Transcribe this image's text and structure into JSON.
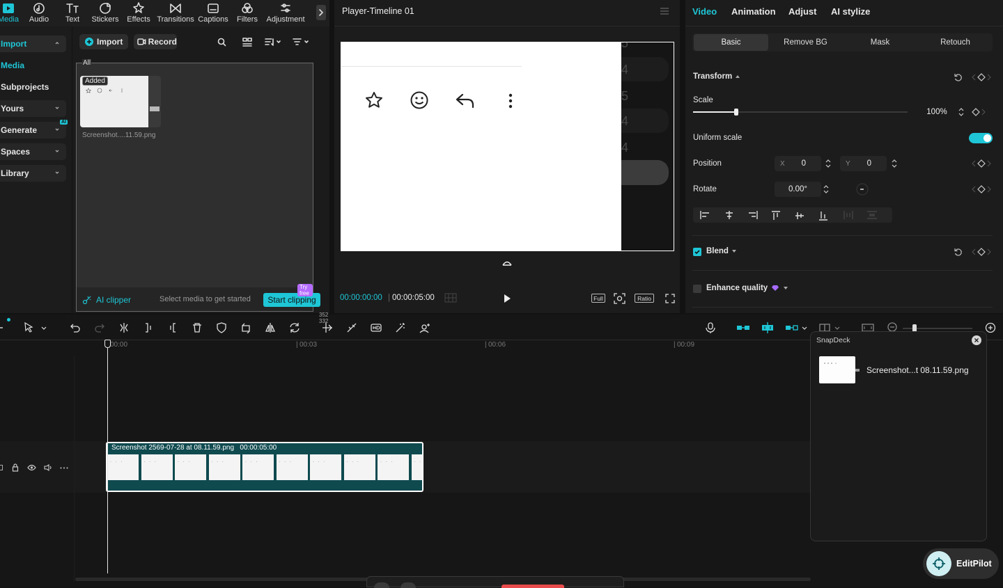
{
  "colors": {
    "accent": "#1ec6d6",
    "clip_bg": "#0f4a4f",
    "bg": "#121212"
  },
  "toolbar": {
    "items": [
      {
        "label": "Media",
        "icon": "media-icon"
      },
      {
        "label": "Audio",
        "icon": "audio-icon"
      },
      {
        "label": "Text",
        "icon": "text-icon"
      },
      {
        "label": "Stickers",
        "icon": "stickers-icon"
      },
      {
        "label": "Effects",
        "icon": "effects-icon"
      },
      {
        "label": "Transitions",
        "icon": "transitions-icon"
      },
      {
        "label": "Captions",
        "icon": "captions-icon"
      },
      {
        "label": "Filters",
        "icon": "filters-icon"
      },
      {
        "label": "Adjustment",
        "icon": "adjustment-icon"
      }
    ]
  },
  "sidebar": {
    "items": [
      {
        "label": "Import"
      },
      {
        "label": "Media"
      },
      {
        "label": "Subprojects"
      },
      {
        "label": "Yours"
      },
      {
        "label": "Generate",
        "badge": "AI"
      },
      {
        "label": "Spaces"
      },
      {
        "label": "Library"
      }
    ]
  },
  "media": {
    "import_label": "Import",
    "record_label": "Record",
    "filter_all": "All",
    "item": {
      "badge": "Added",
      "name": "Screenshot....11.59.png"
    },
    "footer": {
      "ai_clipper": "AI clipper",
      "hint": "Select media to get started",
      "start": "Start clipping",
      "try_free": "Try free"
    }
  },
  "player": {
    "title": "Player-Timeline 01",
    "current_time": "00:00:00:00",
    "total_time": "00:00:05:00",
    "full_label": "Full",
    "ratio_label": "Ratio",
    "side_numbers": [
      "5",
      "4",
      "5",
      "4",
      "4"
    ]
  },
  "inspector": {
    "tabs": [
      "Video",
      "Animation",
      "Adjust",
      "AI stylize"
    ],
    "segments": [
      "Basic",
      "Remove BG",
      "Mask",
      "Retouch"
    ],
    "transform_label": "Transform",
    "scale_label": "Scale",
    "scale_value": "100%",
    "scale_fraction": 0.2,
    "uniform_scale_label": "Uniform scale",
    "uniform_scale_on": true,
    "position_label": "Position",
    "pos_x_label": "X",
    "pos_x": "0",
    "pos_y_label": "Y",
    "pos_y": "0",
    "rotate_label": "Rotate",
    "rotate_value": "0.00°",
    "blend_label": "Blend",
    "blend_checked": true,
    "enhance_label": "Enhance quality",
    "enhance_checked": false
  },
  "timeline": {
    "ruler": [
      "00:00",
      "00:03",
      "00:06",
      "00:09"
    ],
    "clip_title": "Screenshot 2569-07-28 at 08.11.59.png",
    "clip_duration": "00:00:05:00",
    "readout": [
      "352",
      "332"
    ]
  },
  "snapdeck": {
    "title": "SnapDeck",
    "item_name": "Screenshot...t 08.11.59.png"
  },
  "editpilot": {
    "label": "EditPilot"
  }
}
